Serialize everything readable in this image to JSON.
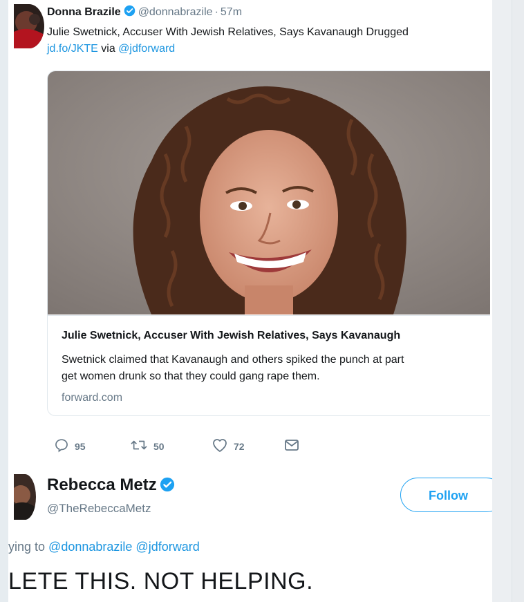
{
  "colors": {
    "link": "#1b95e0",
    "accent": "#1da1f2",
    "secondary_text": "#657786",
    "border": "#e1e8ed"
  },
  "tweet1": {
    "avatar_icon": "user-avatar",
    "display_name": "Donna Brazile",
    "verified_icon": "verified-badge-icon",
    "handle": "@donnabrazile",
    "separator": "·",
    "time": "57m",
    "text_line1": "Julie Swetnick, Accuser With Jewish Relatives, Says Kavanaugh Drugged",
    "link_text": "jd.fo/JKTE",
    "via_text": " via ",
    "mention": "@jdforward",
    "card": {
      "image_alt": "Smiling woman with curly brown hair",
      "title": "Julie Swetnick, Accuser With Jewish Relatives, Says Kavanaugh",
      "description_line1": "Swetnick claimed that Kavanaugh and others spiked the punch at part",
      "description_line2": "get women drunk so that they could gang rape them.",
      "domain": "forward.com"
    },
    "actions": {
      "reply_icon": "reply-icon",
      "reply_count": "95",
      "retweet_icon": "retweet-icon",
      "retweet_count": "50",
      "like_icon": "heart-icon",
      "like_count": "72",
      "message_icon": "envelope-icon"
    }
  },
  "tweet2": {
    "avatar_icon": "user-avatar",
    "display_name": "Rebecca Metz",
    "verified_icon": "verified-badge-icon",
    "handle": "@TheRebeccaMetz",
    "follow_label": "Follow",
    "replying_prefix": "ying to ",
    "replying_mention1": "@donnabrazile",
    "replying_mention2": "@jdforward",
    "text": "LETE THIS. NOT HELPING."
  }
}
